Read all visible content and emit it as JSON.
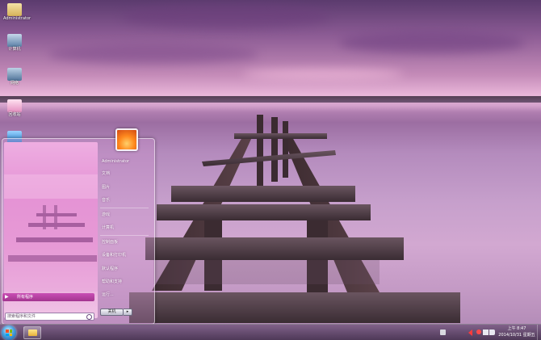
{
  "desktop": {
    "icons": [
      {
        "name": "computer-desktop-icon",
        "label": "Administrator",
        "color": "#e8d8a8"
      },
      {
        "name": "desktop-icon-2",
        "label": "计算机",
        "color": "#7fa6c8"
      },
      {
        "name": "desktop-icon-3",
        "label": "网络",
        "color": "#6c8fb5"
      },
      {
        "name": "recycle-bin-icon",
        "label": "回收站",
        "color": "#f4b8d8"
      },
      {
        "name": "desktop-icon-5",
        "label": "",
        "color": "#3aa0e0"
      }
    ]
  },
  "start_menu": {
    "all_programs": "所有程序",
    "search_placeholder": "搜索程序和文件",
    "user_name": "Administrator",
    "items": [
      "文档",
      "图片",
      "音乐",
      "游戏",
      "计算机",
      "控制面板",
      "设备和打印机",
      "默认程序",
      "帮助和支持",
      "运行..."
    ],
    "shutdown_label": "关机",
    "shutdown_arrow": "▸"
  },
  "taskbar": {
    "time": "上午 8:47",
    "date": "2014/10/31 星期五"
  },
  "colors": {
    "accent": "#c94fb5",
    "taskbar": "#5a4066"
  }
}
